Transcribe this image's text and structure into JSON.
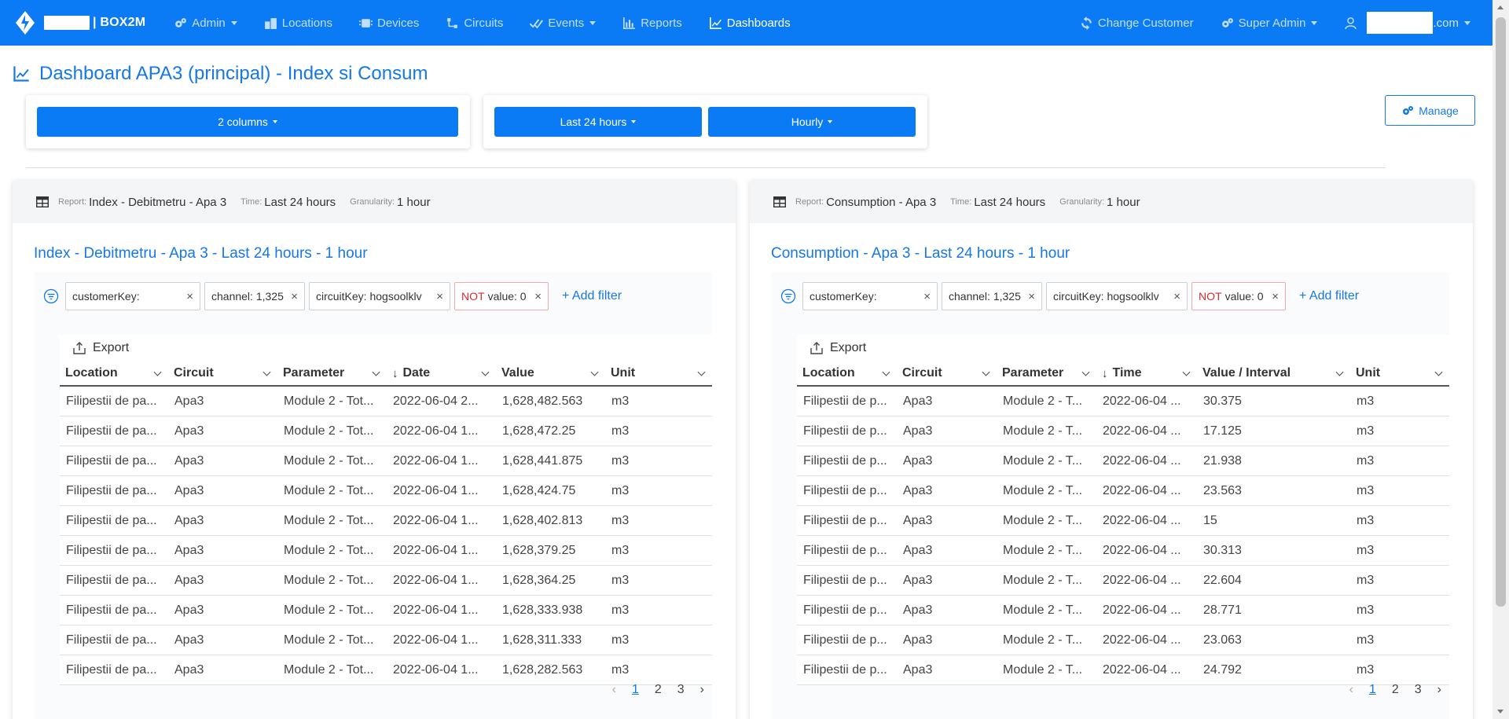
{
  "navbar": {
    "brand": "| BOX2M",
    "items": [
      {
        "label": "Admin",
        "icon": "gears-icon",
        "caret": true,
        "active": false
      },
      {
        "label": "Locations",
        "icon": "buildings-icon",
        "caret": false,
        "active": false
      },
      {
        "label": "Devices",
        "icon": "chip-icon",
        "caret": false,
        "active": false
      },
      {
        "label": "Circuits",
        "icon": "circuit-icon",
        "caret": false,
        "active": false
      },
      {
        "label": "Events",
        "icon": "check-events-icon",
        "caret": true,
        "active": false
      },
      {
        "label": "Reports",
        "icon": "bar-chart-icon",
        "caret": false,
        "active": false
      },
      {
        "label": "Dashboards",
        "icon": "line-chart-icon",
        "caret": false,
        "active": true
      }
    ],
    "right": {
      "change_customer": "Change Customer",
      "super_admin": "Super Admin",
      "user_suffix": ".com"
    }
  },
  "page": {
    "title": "Dashboard APA3 (principal) - Index si Consum",
    "columns_button": "2 columns",
    "time_button": "Last 24 hours",
    "granularity_button": "Hourly",
    "manage_button": "Manage"
  },
  "panels": [
    {
      "report_label": "Report:",
      "report": "Index - Debitmetru - Apa 3",
      "time_label": "Time:",
      "time": "Last 24 hours",
      "gran_label": "Granularity:",
      "granularity": "1 hour",
      "title": "Index - Debitmetru - Apa 3 - Last 24 hours - 1 hour",
      "filters": [
        {
          "label": "customerKey:",
          "negated": false
        },
        {
          "label": "channel: 1,325",
          "negated": false
        },
        {
          "label": "circuitKey: hogsoolklv",
          "negated": false
        },
        {
          "label": "value: 0",
          "negated": true
        }
      ],
      "not_word": "NOT",
      "add_filter": "+ Add filter",
      "export": "Export",
      "columns": [
        "Location",
        "Circuit",
        "Parameter",
        "Date",
        "Value",
        "Unit"
      ],
      "rows": [
        [
          "Filipestii de pa...",
          "Apa3",
          "Module 2 - Tot...",
          "2022-06-04 2...",
          "1,628,482.563",
          "m3"
        ],
        [
          "Filipestii de pa...",
          "Apa3",
          "Module 2 - Tot...",
          "2022-06-04 1...",
          "1,628,472.25",
          "m3"
        ],
        [
          "Filipestii de pa...",
          "Apa3",
          "Module 2 - Tot...",
          "2022-06-04 1...",
          "1,628,441.875",
          "m3"
        ],
        [
          "Filipestii de pa...",
          "Apa3",
          "Module 2 - Tot...",
          "2022-06-04 1...",
          "1,628,424.75",
          "m3"
        ],
        [
          "Filipestii de pa...",
          "Apa3",
          "Module 2 - Tot...",
          "2022-06-04 1...",
          "1,628,402.813",
          "m3"
        ],
        [
          "Filipestii de pa...",
          "Apa3",
          "Module 2 - Tot...",
          "2022-06-04 1...",
          "1,628,379.25",
          "m3"
        ],
        [
          "Filipestii de pa...",
          "Apa3",
          "Module 2 - Tot...",
          "2022-06-04 1...",
          "1,628,364.25",
          "m3"
        ],
        [
          "Filipestii de pa...",
          "Apa3",
          "Module 2 - Tot...",
          "2022-06-04 1...",
          "1,628,333.938",
          "m3"
        ],
        [
          "Filipestii de pa...",
          "Apa3",
          "Module 2 - Tot...",
          "2022-06-04 1...",
          "1,628,311.333",
          "m3"
        ],
        [
          "Filipestii de pa...",
          "Apa3",
          "Module 2 - Tot...",
          "2022-06-04 1...",
          "1,628,282.563",
          "m3"
        ]
      ],
      "pages": [
        "1",
        "2",
        "3"
      ]
    },
    {
      "report_label": "Report:",
      "report": "Consumption - Apa 3",
      "time_label": "Time:",
      "time": "Last 24 hours",
      "gran_label": "Granularity:",
      "granularity": "1 hour",
      "title": "Consumption - Apa 3 - Last 24 hours - 1 hour",
      "filters": [
        {
          "label": "customerKey:",
          "negated": false
        },
        {
          "label": "channel: 1,325",
          "negated": false
        },
        {
          "label": "circuitKey: hogsoolklv",
          "negated": false
        },
        {
          "label": "value: 0",
          "negated": true
        }
      ],
      "not_word": "NOT",
      "add_filter": "+ Add filter",
      "export": "Export",
      "columns": [
        "Location",
        "Circuit",
        "Parameter",
        "Time",
        "Value / Interval",
        "Unit"
      ],
      "rows": [
        [
          "Filipestii de p...",
          "Apa3",
          "Module 2 - T...",
          "2022-06-04 ...",
          "30.375",
          "m3"
        ],
        [
          "Filipestii de p...",
          "Apa3",
          "Module 2 - T...",
          "2022-06-04 ...",
          "17.125",
          "m3"
        ],
        [
          "Filipestii de p...",
          "Apa3",
          "Module 2 - T...",
          "2022-06-04 ...",
          "21.938",
          "m3"
        ],
        [
          "Filipestii de p...",
          "Apa3",
          "Module 2 - T...",
          "2022-06-04 ...",
          "23.563",
          "m3"
        ],
        [
          "Filipestii de p...",
          "Apa3",
          "Module 2 - T...",
          "2022-06-04 ...",
          "15",
          "m3"
        ],
        [
          "Filipestii de p...",
          "Apa3",
          "Module 2 - T...",
          "2022-06-04 ...",
          "30.313",
          "m3"
        ],
        [
          "Filipestii de p...",
          "Apa3",
          "Module 2 - T...",
          "2022-06-04 ...",
          "22.604",
          "m3"
        ],
        [
          "Filipestii de p...",
          "Apa3",
          "Module 2 - T...",
          "2022-06-04 ...",
          "28.771",
          "m3"
        ],
        [
          "Filipestii de p...",
          "Apa3",
          "Module 2 - T...",
          "2022-06-04 ...",
          "23.063",
          "m3"
        ],
        [
          "Filipestii de p...",
          "Apa3",
          "Module 2 - T...",
          "2022-06-04 ...",
          "24.792",
          "m3"
        ]
      ],
      "pages": [
        "1",
        "2",
        "3"
      ]
    }
  ],
  "colors": {
    "primary": "#0a7bf5",
    "title_blue": "#1578e6",
    "negated": "#d32f2f"
  }
}
